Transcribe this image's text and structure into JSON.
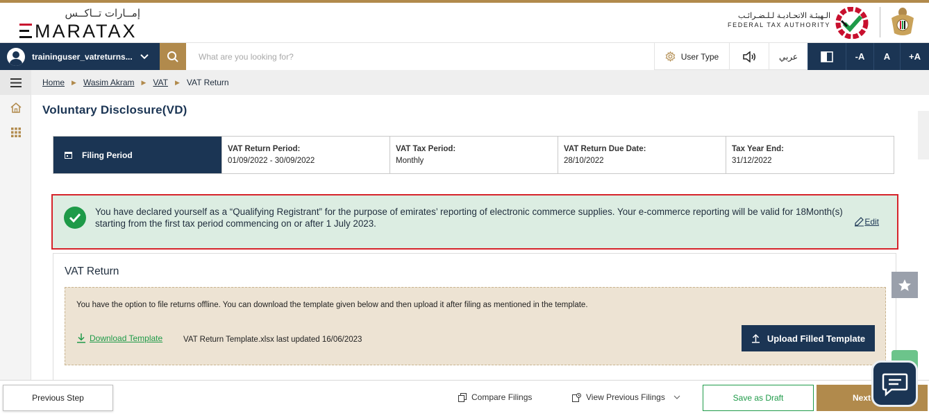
{
  "brand": {
    "logo_ar": "إمــارات تــاكــس",
    "logo_en": "MARATAX",
    "authority_ar": "الـهيئـة الاتحـاديـة لـلـضـرائـب",
    "authority_en": "FEDERAL TAX AUTHORITY",
    "accent_color": "#b18a4c",
    "primary_color": "#1b3554"
  },
  "toolbar": {
    "username": "traininguser_vatreturns...",
    "search_placeholder": "What are you looking for?",
    "user_type_label": "User Type",
    "arabic_label": "عربي",
    "font_decrease": "-A",
    "font_normal": "A",
    "font_increase": "+A"
  },
  "breadcrumb": {
    "items": [
      "Home",
      "Wasim Akram",
      "VAT"
    ],
    "current": "VAT Return"
  },
  "page": {
    "title": "Voluntary Disclosure(VD)"
  },
  "filing_period": {
    "heading": "Filing Period",
    "cells": [
      {
        "label": "VAT Return Period:",
        "value": "01/09/2022 - 30/09/2022"
      },
      {
        "label": "VAT Tax Period:",
        "value": "Monthly"
      },
      {
        "label": "VAT Return Due Date:",
        "value": "28/10/2022"
      },
      {
        "label": "Tax Year End:",
        "value": "31/12/2022"
      }
    ]
  },
  "notice": {
    "text": "You have declared yourself as a “Qualifying Registrant” for the purpose of emirates’ reporting of electronic commerce supplies. Your e-commerce reporting will be valid for 18Month(s) starting from the first tax period commencing on or after 1 July 2023.",
    "edit_label": "Edit"
  },
  "vat_return": {
    "title": "VAT Return",
    "offline_text": "You have the option to file returns offline. You can download the template given below and then upload it after filing as mentioned in the template.",
    "download_label": "Download Template",
    "template_info": "VAT Return Template.xlsx last updated 16/06/2023",
    "upload_label": "Upload Filled Template"
  },
  "footer": {
    "previous_label": "Previous Step",
    "compare_label": "Compare Filings",
    "view_previous_label": "View Previous Filings",
    "save_draft_label": "Save as Draft",
    "next_label": "Next"
  }
}
